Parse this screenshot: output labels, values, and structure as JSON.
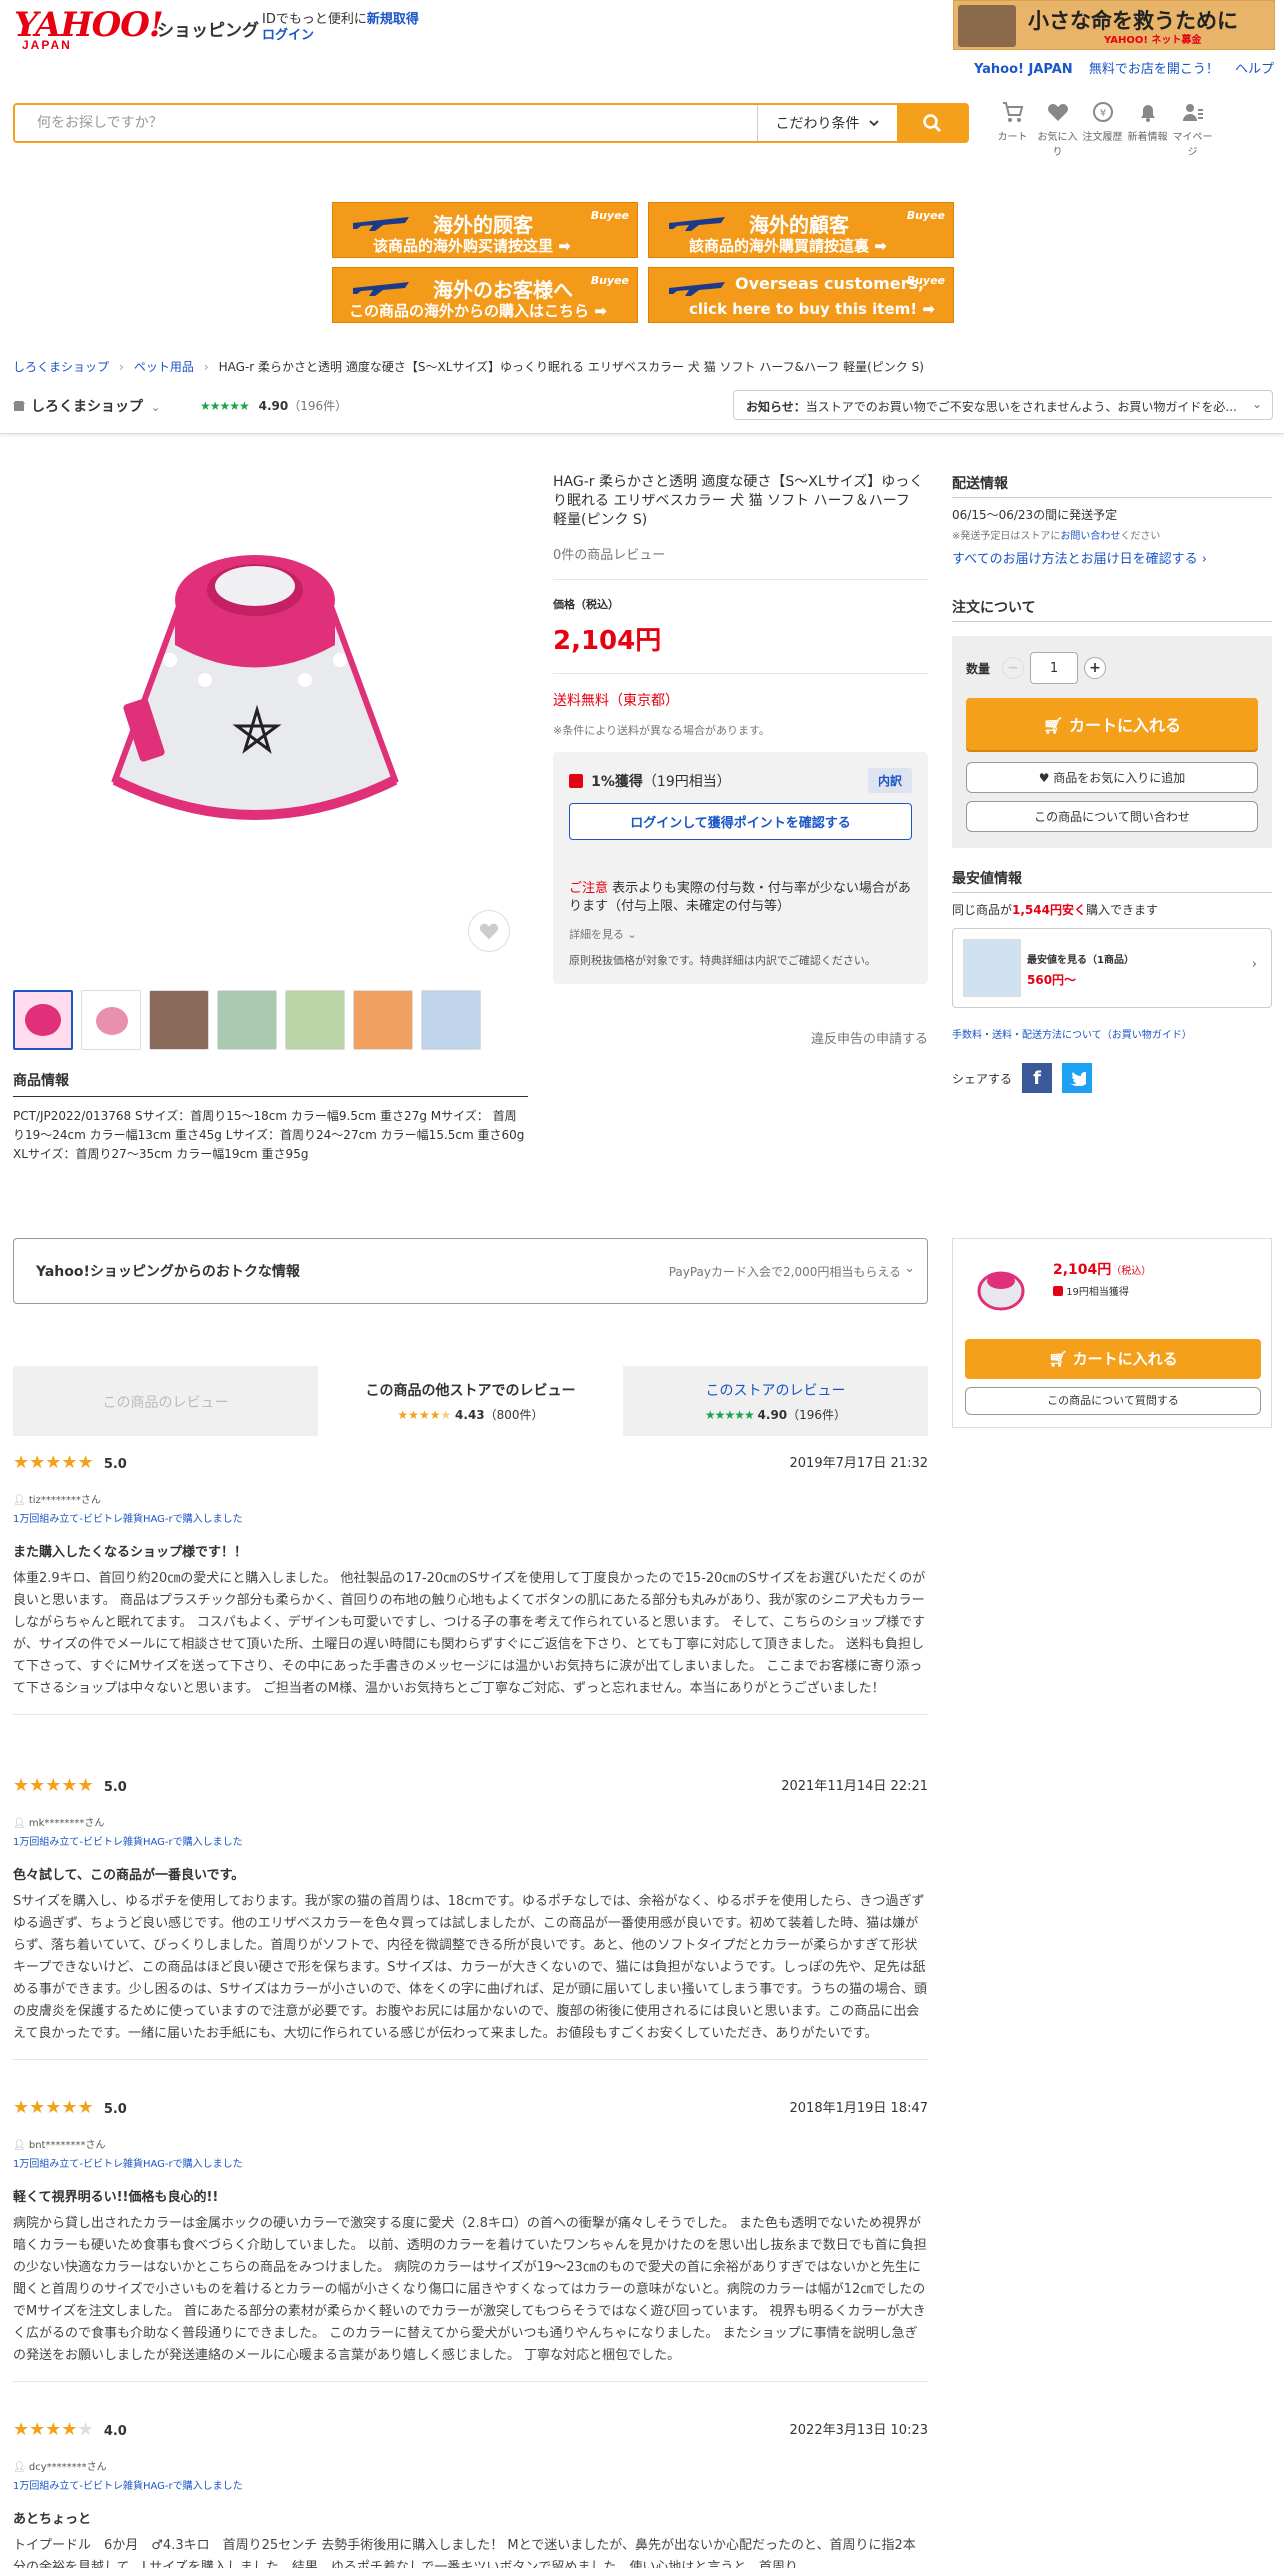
{
  "header": {
    "logo_text": "YAHOO!",
    "logo_sub": "JAPAN",
    "shop_label": "ショッピング",
    "id_text": "IDでもっと便利に",
    "register": "新規取得",
    "login": "ログイン",
    "banner_title": "小さな命を救うために",
    "banner_sub": "YAHOO! ネット募金",
    "top_links": [
      "Yahoo! JAPAN",
      "無料でお店を開こう！",
      "ヘルプ"
    ]
  },
  "search": {
    "placeholder": "何をお探しですか？",
    "condition_label": "こだわり条件"
  },
  "nav_icons": [
    {
      "label": "カート",
      "icon": "cart-icon"
    },
    {
      "label": "お気に入り",
      "icon": "heart-icon"
    },
    {
      "label": "注文履歴",
      "icon": "history-icon"
    },
    {
      "label": "新着情報",
      "icon": "bell-icon"
    },
    {
      "label": "マイページ",
      "icon": "user-icon"
    }
  ],
  "buyee": [
    {
      "line1": "海外的顾客",
      "line2": "该商品的海外购买请按这里 ➡"
    },
    {
      "line1": "海外的顧客",
      "line2": "該商品的海外購買請按這裏 ➡"
    },
    {
      "line1": "海外のお客様へ",
      "line2": "この商品の海外からの購入はこちら ➡"
    },
    {
      "line1": "Overseas customers,",
      "line2": "click here to buy this item! ➡"
    }
  ],
  "buyee_brand": "Buyee",
  "breadcrumb": [
    "しろくまショップ",
    "ペット用品",
    "HAG-r 柔らかさと透明 適度な硬さ【S〜XLサイズ】ゆっくり眠れる エリザベスカラー 犬 猫 ソフト ハーフ&ハーフ 軽量(ピンク S)"
  ],
  "store": {
    "name": "しろくまショップ",
    "rating": "4.90",
    "count": "（196件）",
    "notice_label": "お知らせ：",
    "notice_text": "当ストアでのお買い物でご不安な思いをされませんよう、お買い物ガイドを必..."
  },
  "product": {
    "title": "HAG-r 柔らかさと透明 適度な硬さ【S〜XLサイズ】ゆっくり眠れる エリザベスカラー 犬 猫 ソフト ハーフ＆ハーフ 軽量(ピンク S)",
    "review_count": "0件の商品レビュー",
    "price_label": "価格（税込）",
    "price": "2,104円",
    "shipping": "送料無料（東京都）",
    "shipping_note": "※条件により送料が異なる場合があります。",
    "point_rate": "1%獲得",
    "point_value": "（19円相当）",
    "point_badge": "内訳",
    "point_login_btn": "ログインして獲得ポイントを確認する",
    "caution_label": "ご注意",
    "caution_text": "表示よりも実際の付与数・付与率が少ない場合があります（付与上限、未確定の付与等）",
    "detail_link": "詳細を見る",
    "tax_note": "原則税抜価格が対象です。特典詳細は内訳でご確認ください。",
    "report": "違反申告の申請する",
    "info_title": "商品情報",
    "info_text": "PCT/JP2022/013768 Sサイズ：首周り15〜18cm カラー幅9.5cm 重さ27g Mサイズ： 首周り19〜24cm カラー幅13cm 重さ45g Lサイズ：首周り24〜27cm カラー幅15.5cm 重さ60g XLサイズ：首周り27〜35cm カラー幅19cm 重さ95g"
  },
  "delivery": {
    "title": "配送情報",
    "date": "06/15〜06/23の間に発送予定",
    "note_prefix": "※発送予定日はストアに",
    "note_link": "お問い合わせ",
    "note_suffix": "ください",
    "all_link": "すべてのお届け方法とお届け日を確認する"
  },
  "order": {
    "title": "注文について",
    "qty_label": "数量",
    "qty": "1",
    "cart_btn": "カートに入れる",
    "fav_btn": "商品をお気に入りに追加",
    "ask_btn": "この商品について問い合わせ"
  },
  "cheapest": {
    "title": "最安値情報",
    "text_pre": "同じ商品が",
    "amount": "1,544円安く",
    "text_post": "購入できます",
    "label": "最安値を見る（1商品）",
    "price": "560円〜"
  },
  "guide_link": "手数料・送料・配送方法について（お買い物ガイド）",
  "share_label": "シェアする",
  "promo": {
    "title": "Yahoo!ショッピングからのおトクな情報",
    "right": "PayPayカード入会で2,000円相当もらえる"
  },
  "sidecard": {
    "price": "2,104円",
    "tax": "（税込）",
    "points": "19円相当獲得",
    "cart_btn": "カートに入れる",
    "ask_btn": "この商品について質問する"
  },
  "review_tabs": [
    {
      "label": "この商品のレビュー"
    },
    {
      "label": "この商品の他ストアでのレビュー",
      "rating": "4.43",
      "count": "（800件）"
    },
    {
      "label": "このストアのレビュー",
      "rating": "4.90",
      "count": "（196件）"
    }
  ],
  "reviews": [
    {
      "stars": 5,
      "score": "5.0",
      "date": "2019年7月17日 21:32",
      "user": "tiz********さん",
      "bought": "1万回組み立て-ビビトレ雑貨HAG-rで購入しました",
      "title": "また購入したくなるショップ様です！！",
      "body": "体重2.9キロ、首回り約20㎝の愛犬にと購入しました。 他社製品の17-20㎝のSサイズを使用して丁度良かったので15-20㎝のSサイズをお選びいただくのが良いと思います。 商品はプラスチック部分も柔らかく、首回りの布地の触り心地もよくてボタンの肌にあたる部分も丸みがあり、我が家のシニア犬もカラーしながらちゃんと眠れてます。 コスパもよく、デザインも可愛いですし、つける子の事を考えて作られていると思います。 そして、こちらのショップ様ですが、サイズの件でメールにて相談させて頂いた所、土曜日の遅い時間にも関わらずすぐにご返信を下さり、とても丁寧に対応して頂きました。 送料も負担して下さって、すぐにMサイズを送って下さり、その中にあった手書きのメッセージには温かいお気持ちに涙が出てしまいました。 ここまでお客様に寄り添って下さるショップは中々ないと思います。 ご担当者のM様、温かいお気持ちとご丁寧なご対応、ずっと忘れません。本当にありがとうございました！"
    },
    {
      "stars": 5,
      "score": "5.0",
      "date": "2021年11月14日 22:21",
      "user": "mk********さん",
      "bought": "1万回組み立て-ビビトレ雑貨HAG-rで購入しました",
      "title": "色々試して、この商品が一番良いです。",
      "body": "Sサイズを購入し、ゆるポチを使用しております。我が家の猫の首周りは、18cmです。ゆるポチなしでは、余裕がなく、ゆるポチを使用したら、きつ過ぎずゆる過ぎず、ちょうど良い感じです。他のエリザベスカラーを色々買っては試しましたが、この商品が一番使用感が良いです。初めて装着した時、猫は嫌がらず、落ち着いていて、びっくりしました。首周りがソフトで、内径を微調整できる所が良いです。あと、他のソフトタイプだとカラーが柔らかすぎて形状キープできないけど、この商品はほど良い硬さで形を保ちます。Sサイズは、カラーが大きくないので、猫には負担がないようです。しっぽの先や、足先は舐める事ができます。少し困るのは、Sサイズはカラーが小さいので、体をくの字に曲げれば、足が頭に届いてしまい掻いてしまう事です。うちの猫の場合、頭の皮膚炎を保護するために使っていますので注意が必要です。お腹やお尻には届かないので、腹部の術後に使用されるには良いと思います。この商品に出会えて良かったです。一緒に届いたお手紙にも、大切に作られている感じが伝わって来ました。お値段もすごくお安くしていただき、ありがたいです。"
    },
    {
      "stars": 5,
      "score": "5.0",
      "date": "2018年1月19日 18:47",
      "user": "bnt********さん",
      "bought": "1万回組み立て-ビビトレ雑貨HAG-rで購入しました",
      "title": "軽くて視界明るい!!価格も良心的!!",
      "body": "病院から貸し出されたカラーは金属ホックの硬いカラーで激突する度に愛犬（2.8キロ）の首への衝撃が痛々しそうでした。 また色も透明でないため視界が暗くカラーも硬いため食事も食べづらく介助していました。 以前、透明のカラーを着けていたワンちゃんを見かけたのを思い出し抜糸まで数日でも首に負担の少ない快適なカラーはないかとこちらの商品をみつけました。 病院のカラーはサイズが19〜23㎝のもので愛犬の首に余裕がありすぎではないかと先生に聞くと首周りのサイズで小さいものを着けるとカラーの幅が小さくなり傷口に届きやすくなってはカラーの意味がないと。病院のカラーは幅が12㎝でしたのでMサイズを注文しました。 首にあたる部分の素材が柔らかく軽いのでカラーが激突してもつらそうではなく遊び回っています。 視界も明るくカラーが大きく広がるので食事も介助なく普段通りにできました。 このカラーに替えてから愛犬がいつも通りやんちゃになりました。 またショップに事情を説明し急ぎの発送をお願いしましたが発送連絡のメールに心暖まる言葉があり嬉しく感じました。 丁寧な対応と梱包でした。"
    },
    {
      "stars": 4,
      "score": "4.0",
      "date": "2022年3月13日 10:23",
      "user": "dcy********さん",
      "bought": "1万回組み立て-ビビトレ雑貨HAG-rで購入しました",
      "title": "あとちょっと",
      "body": "トイプードル　6か月　♂4.3キロ　首周り25センチ 去勢手術後用に購入しました！ Mとで迷いましたが、鼻先が出ないか心配だったのと、首周りに指2本分の余裕を見越して、Lサイズを購入しました。結果、ゆるポチ着なしで一番キツいボタンで留めました。使い心地はと言うと、首周り"
    }
  ]
}
